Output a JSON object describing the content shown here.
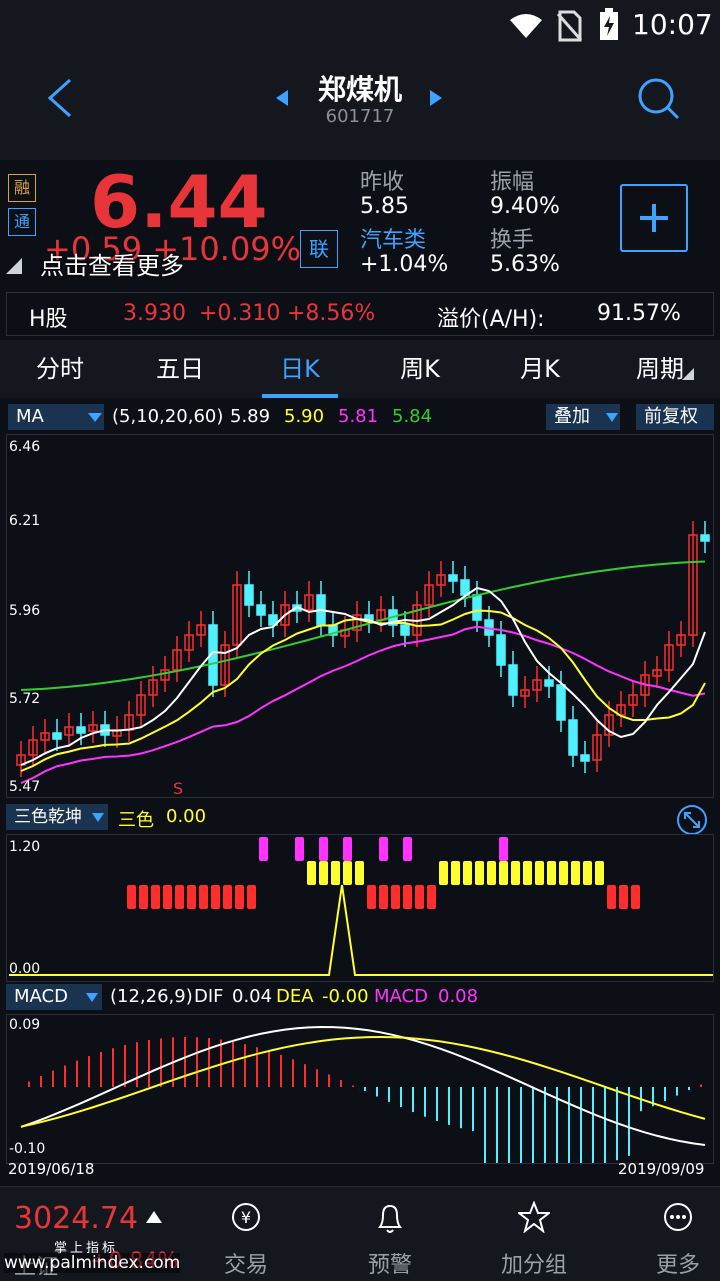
{
  "status": {
    "time": "10:07"
  },
  "header": {
    "name": "郑煤机",
    "code": "601717"
  },
  "quote": {
    "price": "6.44",
    "change_overlay": "+0.59  +10.09%",
    "more_hint": "点击查看更多",
    "tag_rong": "融",
    "tag_tong": "通",
    "tag_lian": "联",
    "prev_close_label": "昨收",
    "prev_close": "5.85",
    "amplitude_label": "振幅",
    "amplitude": "9.40%",
    "sector_label": "汽车类",
    "sector_change": "+1.04%",
    "turnover_label": "换手",
    "turnover": "5.63%"
  },
  "hshare": {
    "label": "H股",
    "price": "3.930",
    "change": "+0.310",
    "pct": "+8.56%",
    "premium_label": "溢价(A/H):",
    "premium": "91.57%"
  },
  "tabs": [
    "分时",
    "五日",
    "日K",
    "周K",
    "月K",
    "周期"
  ],
  "active_tab": "日K",
  "ma_bar": {
    "name": "MA",
    "params": "(5,10,20,60)",
    "v1": "5.89",
    "v2": "5.90",
    "v3": "5.81",
    "v4": "5.84",
    "overlay": "叠加",
    "adjust": "前复权"
  },
  "colors": {
    "up": "#ff2d2d",
    "down": "#4ff0ff",
    "ma5": "#ffffff",
    "ma10": "#ffff2d",
    "ma20": "#ff33ff",
    "ma60": "#33cc33",
    "accent": "#3fa2ff"
  },
  "main_axis": {
    "top": "6.46",
    "t2": "6.21",
    "t3": "5.96",
    "t4": "5.72",
    "bottom": "5.47",
    "signal": "S"
  },
  "sanse": {
    "name": "三色乾坤",
    "label": "三色",
    "value": "0.00",
    "max": "1.20",
    "min": "0.00"
  },
  "macd": {
    "name": "MACD",
    "params": "(12,26,9)",
    "dif_label": "DIF",
    "dif": "0.04",
    "dea_label": "DEA",
    "dea": "-0.00",
    "macd_label": "MACD",
    "macd": "0.08",
    "max": "0.09",
    "min": "-0.10",
    "date_start": "2019/06/18",
    "date_end": "2019/09/09"
  },
  "bottom": {
    "index_name": "上证",
    "index_value": "3024.74",
    "index_change": "+0.84%",
    "watermark": "掌上指标",
    "watermark_url": "www.palmindex.com",
    "items": [
      "交易",
      "预警",
      "加分组",
      "更多"
    ]
  }
}
